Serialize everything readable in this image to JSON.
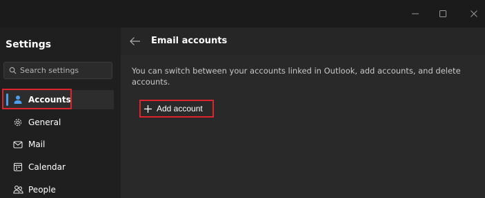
{
  "titlebar": {
    "icons": [
      "minimize-icon",
      "maximize-icon",
      "close-icon"
    ]
  },
  "sidebar": {
    "title": "Settings",
    "search": {
      "placeholder": "Search settings",
      "value": ""
    },
    "items": [
      {
        "label": "Accounts",
        "icon": "person-icon",
        "active": true
      },
      {
        "label": "General",
        "icon": "gear-icon",
        "active": false
      },
      {
        "label": "Mail",
        "icon": "mail-icon",
        "active": false
      },
      {
        "label": "Calendar",
        "icon": "calendar-icon",
        "active": false
      },
      {
        "label": "People",
        "icon": "people-icon",
        "active": false
      }
    ]
  },
  "main": {
    "title": "Email accounts",
    "description": "You can switch between your accounts linked in Outlook, add accounts, and delete accounts.",
    "add_account_label": "Add account"
  },
  "colors": {
    "accent": "#4c9ff0",
    "highlight": "#e0242e",
    "background": "#1f1f1f",
    "panel": "#292929"
  }
}
